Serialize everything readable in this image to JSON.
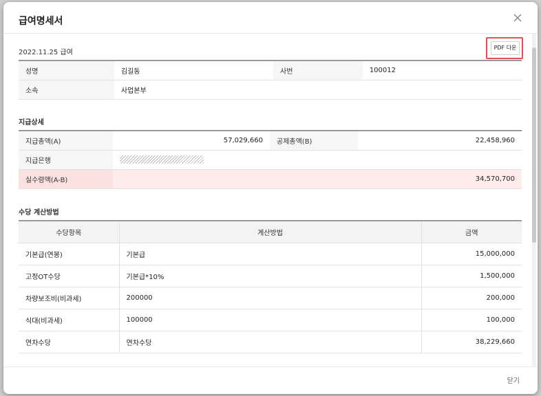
{
  "modal": {
    "title": "급여명세서",
    "close_footer_label": "닫기"
  },
  "header": {
    "pay_date": "2022.11.25 급여",
    "pdf_button_label": "PDF 다운"
  },
  "employee": {
    "name_label": "성명",
    "name_value": "김길동",
    "id_label": "사번",
    "id_value": "100012",
    "dept_label": "소속",
    "dept_value": "사업본부"
  },
  "payment_details": {
    "section_title": "지급상세",
    "total_pay_label": "지급총액(A)",
    "total_pay_value": "57,029,660",
    "total_deduction_label": "공제총액(B)",
    "total_deduction_value": "22,458,960",
    "bank_label": "지급은행",
    "net_pay_label": "실수령액(A-B)",
    "net_pay_value": "34,570,700"
  },
  "allowance_calc": {
    "section_title": "수당 계산방법",
    "headers": [
      "수당항목",
      "계산방법",
      "금액"
    ],
    "rows": [
      {
        "item": "기본급(연봉)",
        "method": "기본급",
        "amount": "15,000,000"
      },
      {
        "item": "고정OT수당",
        "method": "기본급*10%",
        "amount": "1,500,000"
      },
      {
        "item": "차량보조비(비과세)",
        "method": "200000",
        "amount": "200,000"
      },
      {
        "item": "식대(비과세)",
        "method": "100000",
        "amount": "100,000"
      },
      {
        "item": "연차수당",
        "method": "연차수당",
        "amount": "38,229,660"
      }
    ]
  },
  "colors": {
    "highlight_border": "#e0504f",
    "net_pay_bg": "#fdeceb"
  }
}
